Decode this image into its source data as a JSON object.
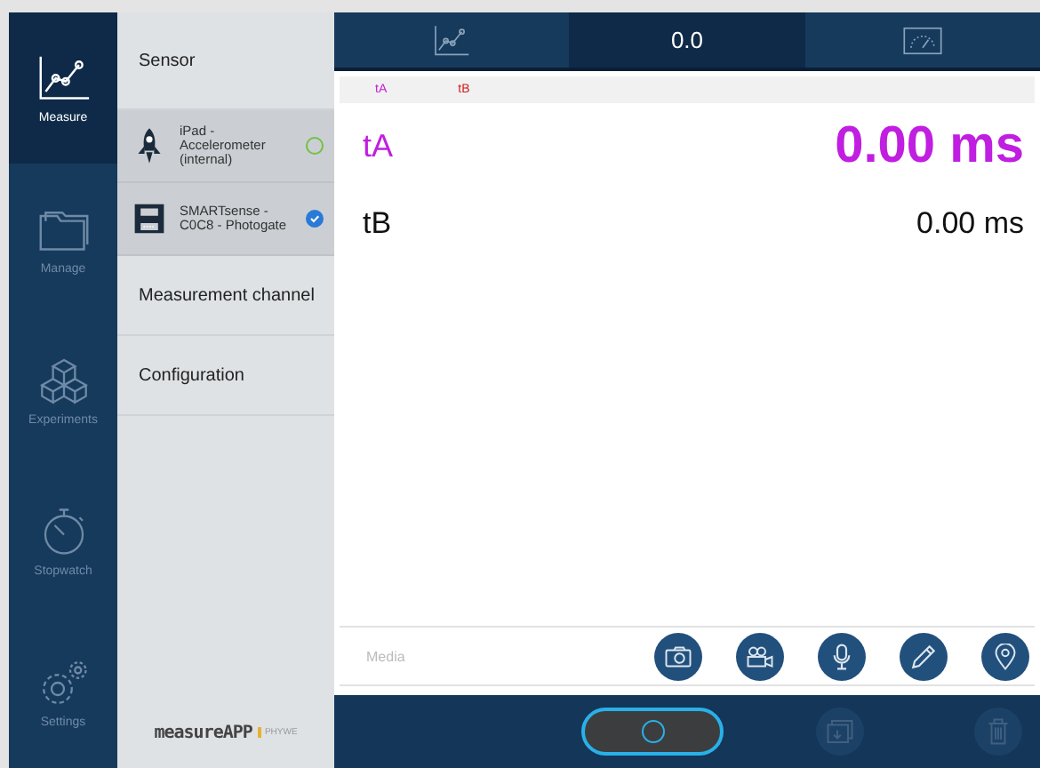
{
  "nav": [
    {
      "label": "Measure",
      "selected": true
    },
    {
      "label": "Manage",
      "selected": false
    },
    {
      "label": "Experiments",
      "selected": false
    },
    {
      "label": "Stopwatch",
      "selected": false
    },
    {
      "label": "Settings",
      "selected": false
    }
  ],
  "sidebar": {
    "heading": "Sensor",
    "sensors": [
      {
        "name": "iPad - Accelerometer (internal)",
        "checked": false
      },
      {
        "name": "SMARTsense - C0C8 - Photogate",
        "checked": true
      }
    ],
    "items": [
      "Measurement channel",
      "Configuration"
    ],
    "logo": {
      "text": "measureAPP",
      "brand": "PHYWE"
    }
  },
  "tabs": [
    {
      "kind": "icon",
      "selected": false
    },
    {
      "kind": "text",
      "label": "0.0",
      "selected": true
    },
    {
      "kind": "icon",
      "selected": false
    }
  ],
  "legend": [
    {
      "label": "tA",
      "color": "#c020d0"
    },
    {
      "label": "tB",
      "color": "#d02020"
    }
  ],
  "readings": [
    {
      "name": "tA",
      "value": "0.00 ms",
      "emphasized": true
    },
    {
      "name": "tB",
      "value": "0.00 ms",
      "emphasized": false
    }
  ],
  "media": {
    "placeholder": "Media"
  },
  "actions": [
    {
      "kind": "record",
      "disabled": false
    },
    {
      "kind": "save",
      "disabled": true
    },
    {
      "kind": "delete",
      "disabled": true
    }
  ]
}
